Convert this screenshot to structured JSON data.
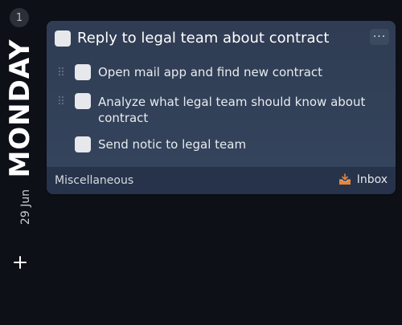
{
  "day": {
    "task_count": "1",
    "name": "MONDAY",
    "date": "29 Jun"
  },
  "task": {
    "title": "Reply to legal team about contract",
    "more_label": "···",
    "subtasks": [
      {
        "label": "Open mail app and find new contract"
      },
      {
        "label": "Analyze what legal team should know about contract"
      },
      {
        "label": "Send notic to legal team"
      }
    ],
    "tag": "Miscellaneous",
    "list": "Inbox",
    "list_icon": "inbox-tray-icon"
  },
  "add_icon": "plus-icon",
  "colors": {
    "background": "#0e1018",
    "card": "#2f3c52",
    "card_footer": "#27334a",
    "checkbox": "#e6e8ec",
    "inbox_accent": "#e8843a"
  }
}
